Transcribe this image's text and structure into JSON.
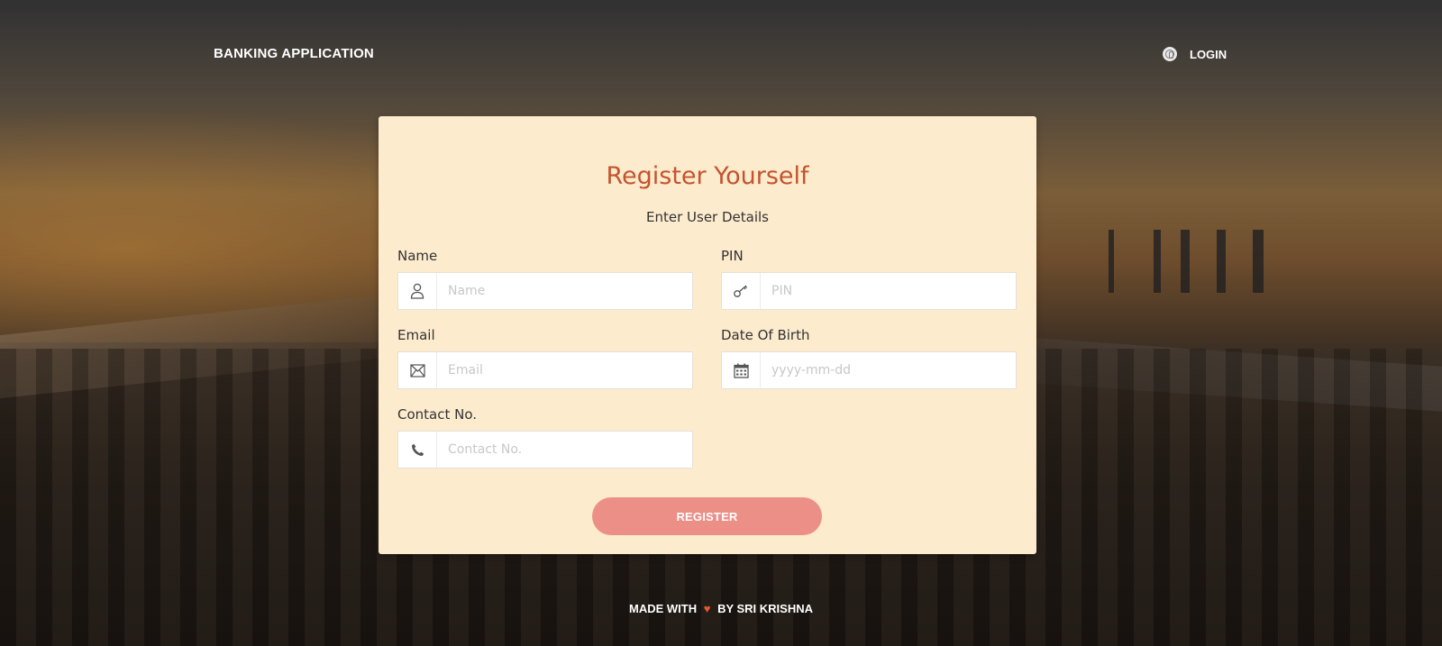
{
  "header": {
    "brand": "BANKING APPLICATION",
    "login_label": "LOGIN",
    "login_icon": "fingerprint-icon"
  },
  "card": {
    "title": "Register Yourself",
    "subtitle": "Enter User Details",
    "fields": {
      "name": {
        "label": "Name",
        "placeholder": "Name",
        "value": "",
        "icon": "user-icon"
      },
      "pin": {
        "label": "PIN",
        "placeholder": "PIN",
        "value": "",
        "icon": "key-icon"
      },
      "email": {
        "label": "Email",
        "placeholder": "Email",
        "value": "",
        "icon": "envelope-icon"
      },
      "dob": {
        "label": "Date Of Birth",
        "placeholder": "yyyy-mm-dd",
        "value": "",
        "icon": "calendar-icon"
      },
      "contact": {
        "label": "Contact No.",
        "placeholder": "Contact No.",
        "value": "",
        "icon": "phone-icon"
      }
    },
    "register_label": "REGISTER"
  },
  "footer": {
    "prefix": "MADE WITH",
    "heart": "♥",
    "suffix": "BY SRI KRISHNA"
  },
  "colors": {
    "card_bg": "#fdebcd",
    "title": "#c4542e",
    "button": "#ec8f87",
    "heart": "#e8582e"
  }
}
